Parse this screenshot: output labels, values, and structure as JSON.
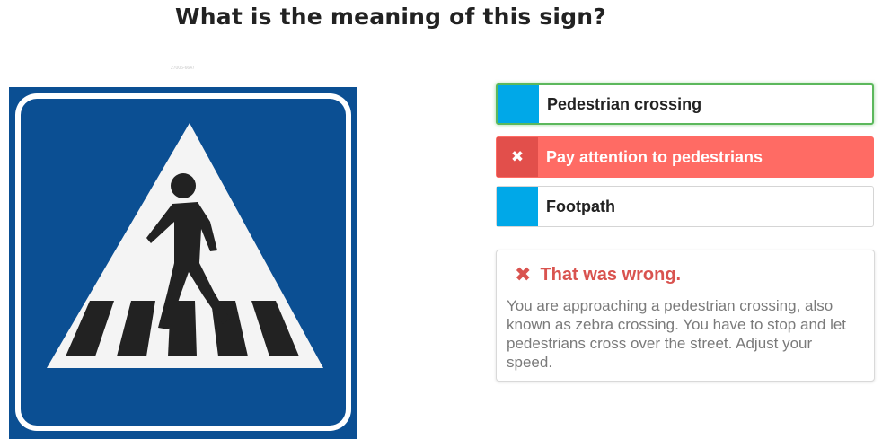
{
  "question": {
    "title": "What is the meaning of this sign?"
  },
  "image": {
    "caption": "27006-6647",
    "subject": "pedestrian-crossing-sign"
  },
  "options": [
    {
      "label": "Pedestrian crossing",
      "state": "correct",
      "marker": ""
    },
    {
      "label": "Pay attention to pedestrians",
      "state": "selected-wrong",
      "marker": "✖"
    },
    {
      "label": "Footpath",
      "state": "neutral",
      "marker": ""
    }
  ],
  "feedback": {
    "icon": "✖",
    "heading": "That was wrong.",
    "text": "You are approaching a pedestrian crossing, also known as zebra crossing. You have to stop and let pedestrians cross over the street. Adjust your speed."
  },
  "colors": {
    "sign_blue": "#0b4f93",
    "option_marker": "#00a8e8",
    "correct_border": "#5cb85c",
    "wrong_bg": "#ff6b64",
    "wrong_marker": "#e24f4b",
    "error_text": "#d9534f"
  }
}
